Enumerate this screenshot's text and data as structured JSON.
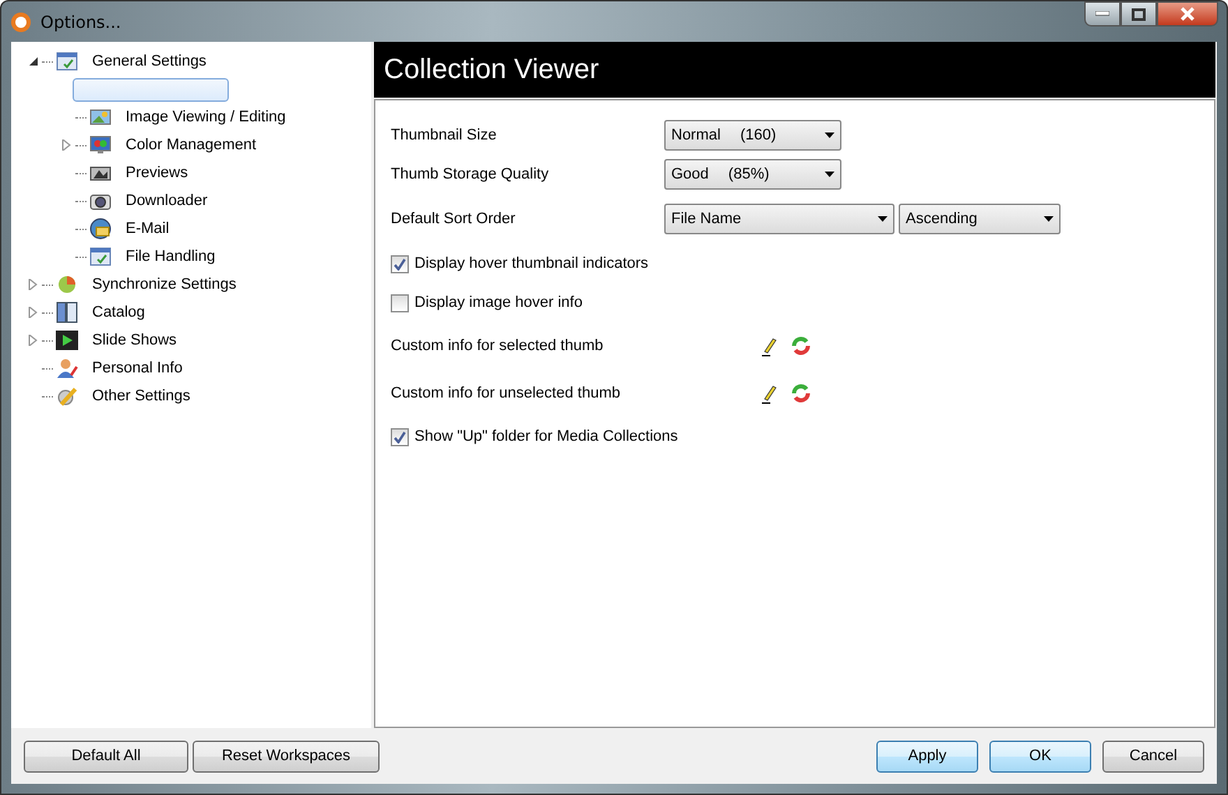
{
  "window": {
    "title": "Options..."
  },
  "tree": [
    {
      "label": "General Settings",
      "expanded": true,
      "selected": false,
      "children": [
        {
          "selected": true
        },
        {
          "label": "Image Viewing / Editing",
          "selected": false
        },
        {
          "label": "Color Management",
          "expanded": false,
          "selected": false
        },
        {
          "label": "Previews",
          "selected": false
        },
        {
          "label": "Downloader",
          "selected": false
        },
        {
          "label": "E-Mail",
          "selected": false
        },
        {
          "label": "File Handling",
          "selected": false
        }
      ]
    },
    {
      "label": "Synchronize Settings",
      "expanded": false,
      "selected": false
    },
    {
      "label": "Catalog",
      "expanded": false,
      "selected": false
    },
    {
      "label": "Slide Shows",
      "expanded": false,
      "selected": false
    },
    {
      "label": "Personal Info",
      "selected": false
    },
    {
      "label": "Other Settings",
      "selected": false
    }
  ],
  "panel": {
    "title": "Collection Viewer",
    "settings": [
      {
        "kind": "select",
        "label": "Thumbnail Size",
        "dropdowns": [
          [
            "Normal",
            "(160)"
          ]
        ]
      },
      {
        "kind": "select",
        "label": "Thumb Storage Quality",
        "dropdowns": [
          [
            "Good",
            "(85%)"
          ]
        ]
      },
      {
        "kind": "select",
        "label": "Default Sort Order",
        "dropdowns": [
          [
            "File Name"
          ],
          [
            "Ascending"
          ]
        ]
      },
      {
        "kind": "checkbox",
        "label": "Display hover thumbnail indicators",
        "checked": true
      },
      {
        "kind": "checkbox",
        "label": "Display image hover info",
        "checked": false
      },
      {
        "kind": "custom",
        "label": "Custom info for selected thumb"
      },
      {
        "kind": "custom",
        "label": "Custom info for unselected thumb"
      },
      {
        "kind": "checkbox",
        "label": "Show \"Up\" folder for Media Collections",
        "checked": true
      }
    ]
  },
  "footer": {
    "left_buttons": [
      "Default All",
      "Reset Workspaces"
    ],
    "right_buttons": [
      {
        "label": "Apply",
        "focused": true
      },
      {
        "label": "OK",
        "focused": true
      },
      {
        "label": "Cancel",
        "focused": false
      }
    ]
  }
}
